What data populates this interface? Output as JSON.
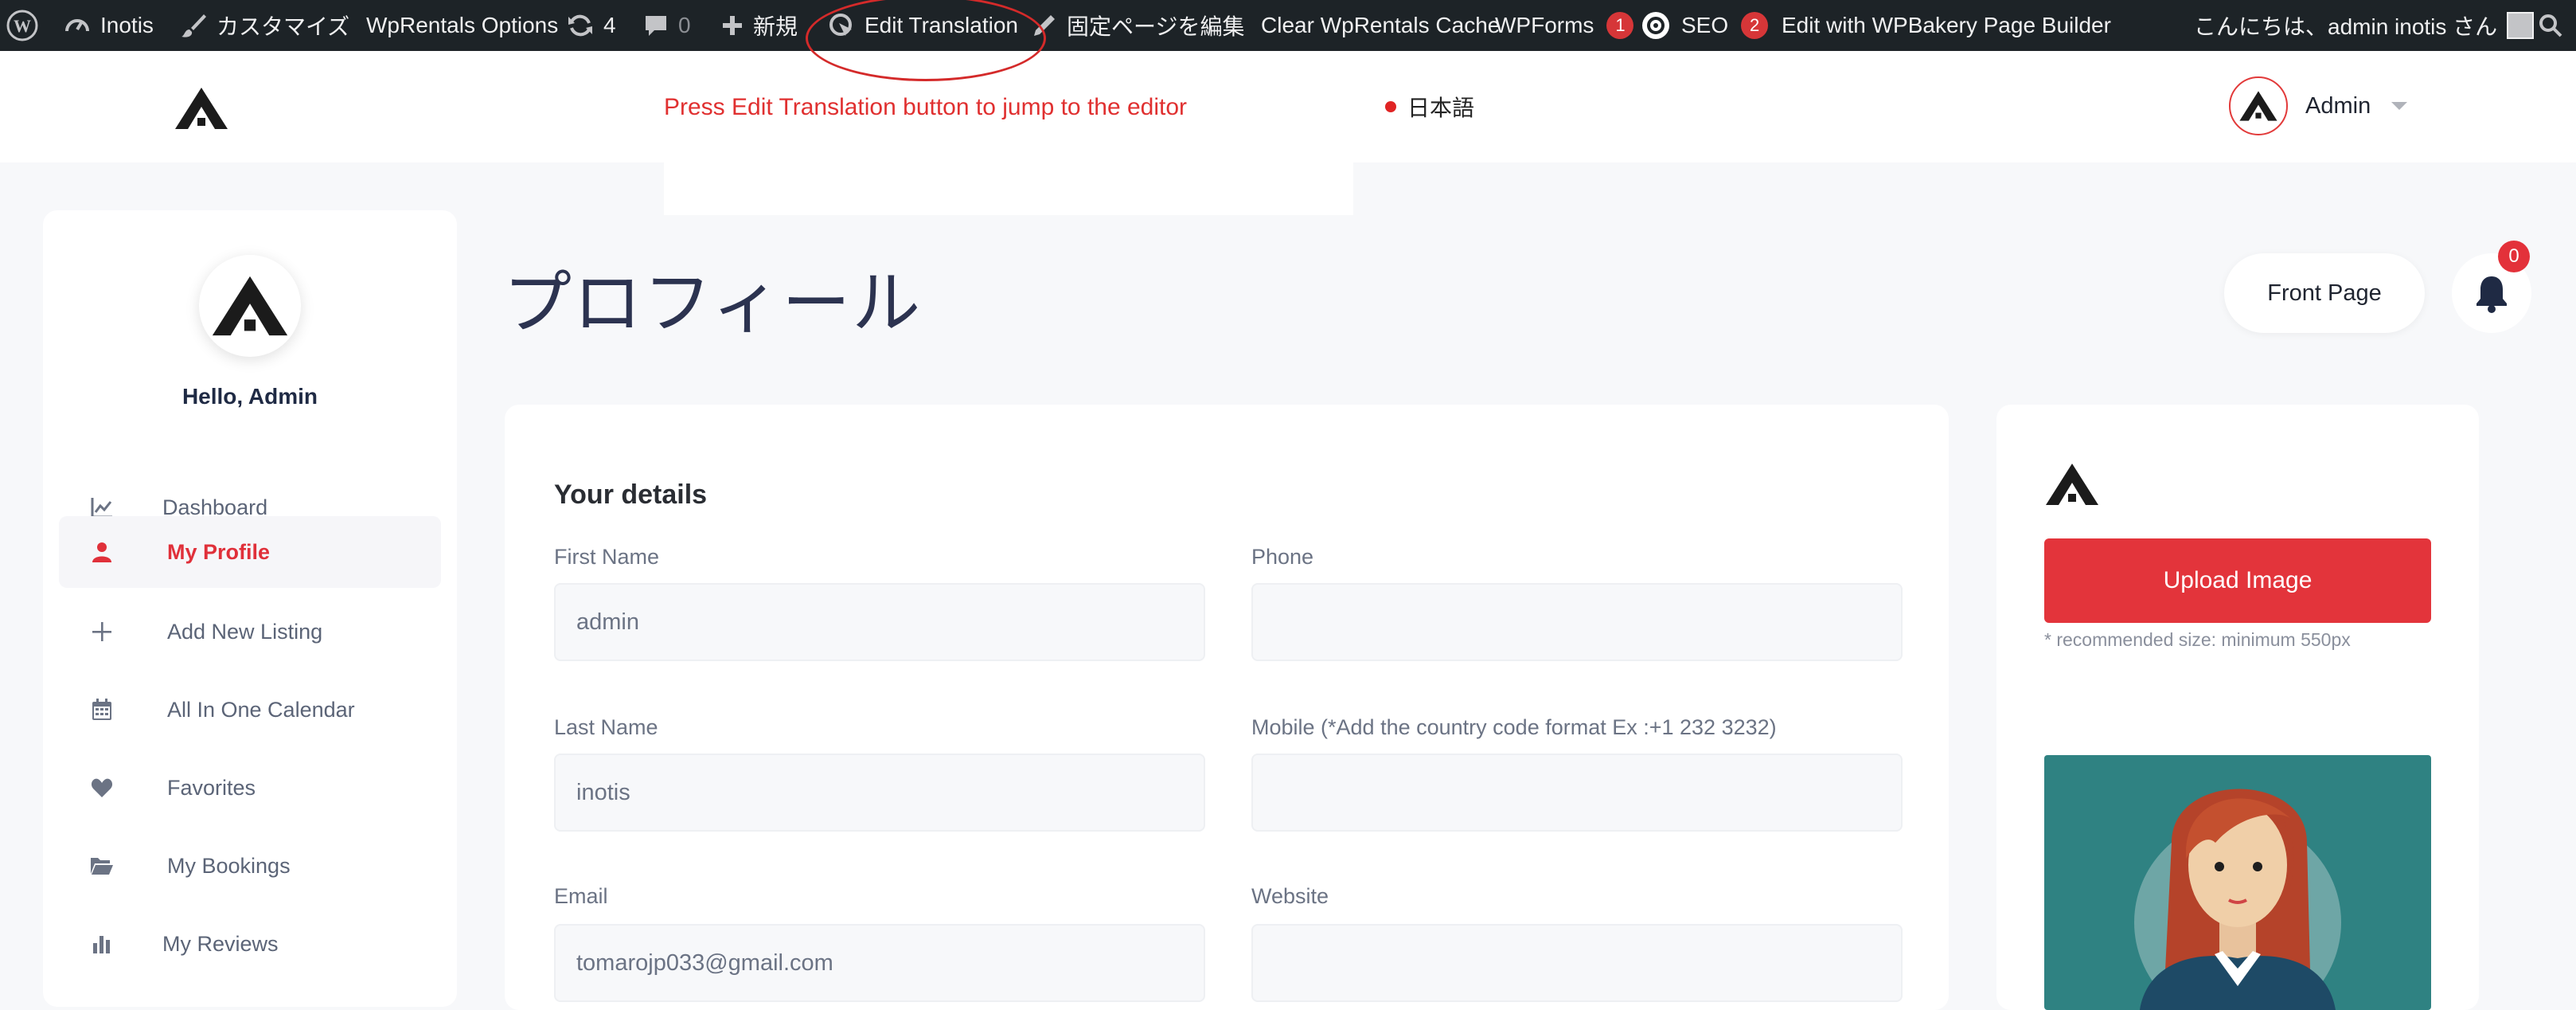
{
  "adminbar": {
    "site_name": "Inotis",
    "customize": "カスタマイズ",
    "wprentals_options": "WpRentals Options",
    "updates_count": "4",
    "comments_count": "0",
    "new": "新規",
    "edit_translation": "Edit Translation",
    "edit_page": "固定ページを編集",
    "clear_cache": "Clear WpRentals Cache",
    "wpforms": "WPForms",
    "wpforms_badge": "1",
    "seo": "SEO",
    "seo_badge": "2",
    "wpbakery": "Edit with WPBakery Page Builder",
    "greeting": "こんにちは、admin inotis さん"
  },
  "annotation": {
    "text": "Press  Edit Translation button to jump to the editor",
    "color": "#e03030"
  },
  "header": {
    "language": "日本語",
    "user_label": "Admin"
  },
  "sidebar": {
    "hello": "Hello, Admin",
    "items": [
      {
        "label": "Dashboard",
        "icon": "chart-line-icon"
      },
      {
        "label": "My Profile",
        "icon": "user-icon",
        "active": true
      },
      {
        "label": "Add New Listing",
        "icon": "plus-icon"
      },
      {
        "label": "All In One Calendar",
        "icon": "calendar-icon"
      },
      {
        "label": "Favorites",
        "icon": "heart-icon"
      },
      {
        "label": "My Bookings",
        "icon": "folder-open-icon"
      },
      {
        "label": "My Reviews",
        "icon": "bar-chart-icon"
      }
    ]
  },
  "main": {
    "page_title": "プロフィール",
    "front_page_button": "Front Page",
    "notifications_count": "0",
    "details": {
      "title": "Your details",
      "fields": {
        "first_name": {
          "label": "First Name",
          "value": "admin"
        },
        "phone": {
          "label": "Phone",
          "value": ""
        },
        "last_name": {
          "label": "Last Name",
          "value": "inotis"
        },
        "mobile": {
          "label": "Mobile (*Add the country code format Ex :+1 232 3232)",
          "value": ""
        },
        "email": {
          "label": "Email",
          "value": "tomarojp033@gmail.com"
        },
        "website": {
          "label": "Website",
          "value": ""
        }
      }
    },
    "image_card": {
      "upload_button": "Upload Image",
      "recommended": "* recommended size: minimum 550px"
    }
  },
  "colors": {
    "accent": "#e3343b",
    "adminbar_bg": "#1d2327",
    "title": "#2c3350"
  }
}
